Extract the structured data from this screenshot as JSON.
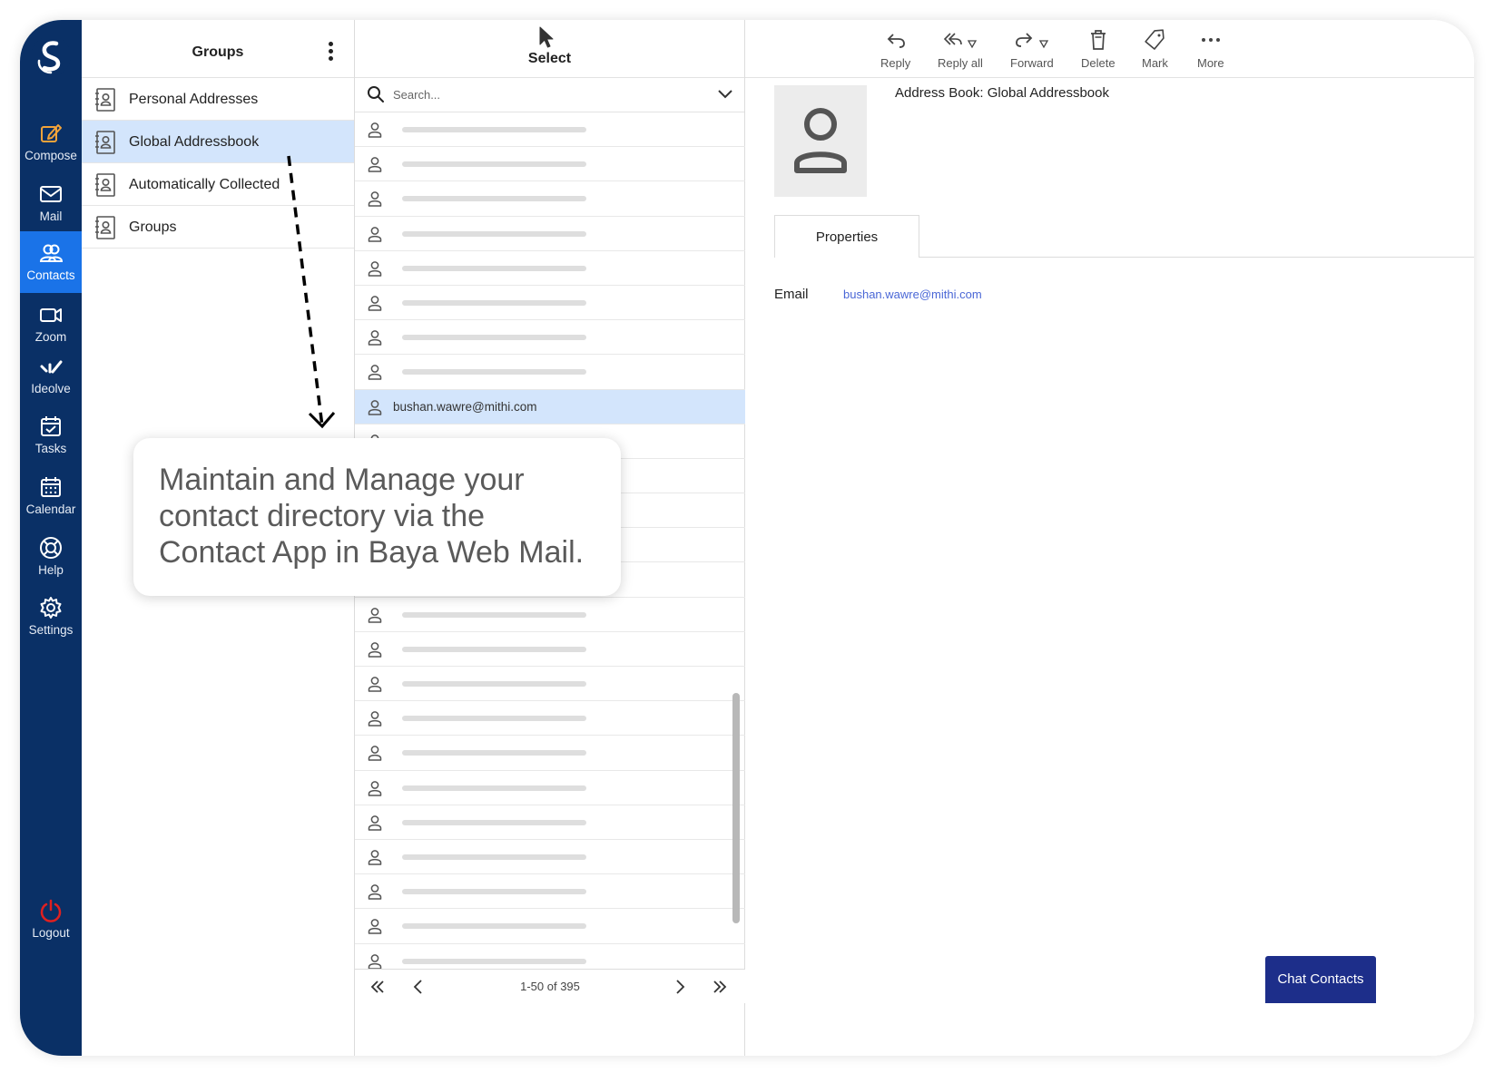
{
  "nav": {
    "items": [
      {
        "label": "Compose",
        "icon": "compose-icon"
      },
      {
        "label": "Mail",
        "icon": "mail-icon"
      },
      {
        "label": "Contacts",
        "icon": "contacts-icon"
      },
      {
        "label": "Zoom",
        "icon": "zoom-icon"
      },
      {
        "label": "Ideolve",
        "icon": "ideolve-icon"
      },
      {
        "label": "Tasks",
        "icon": "tasks-icon"
      },
      {
        "label": "Calendar",
        "icon": "calendar-icon"
      },
      {
        "label": "Help",
        "icon": "help-icon"
      },
      {
        "label": "Settings",
        "icon": "settings-icon"
      }
    ],
    "active": "Contacts",
    "logout": "Logout"
  },
  "groups": {
    "title": "Groups",
    "items": [
      {
        "label": "Personal Addresses",
        "selected": false
      },
      {
        "label": "Global Addressbook",
        "selected": true
      },
      {
        "label": "Automatically Collected",
        "selected": false
      },
      {
        "label": "Groups",
        "selected": false
      }
    ]
  },
  "list": {
    "header": "Select",
    "search_placeholder": "Search...",
    "selected_contact": "bushan.wawre@mithi.com",
    "pagination": "1-50 of 395"
  },
  "toolbar": {
    "reply": "Reply",
    "reply_all": "Reply all",
    "forward": "Forward",
    "delete": "Delete",
    "mark": "Mark",
    "more": "More"
  },
  "detail": {
    "address_book": "Address Book: Global Addressbook",
    "tab": "Properties",
    "email_label": "Email",
    "email_value": "bushan.wawre@mithi.com"
  },
  "chat_button": "Chat Contacts",
  "callout": "Maintain and Manage your contact directory via the Contact App in Baya Web Mail.",
  "colors": {
    "nav_bg": "#0a3066",
    "nav_active": "#1a73e8",
    "selected_row": "#d3e5fc",
    "chat_button": "#1d2e8a",
    "logout_icon": "#e02020"
  }
}
